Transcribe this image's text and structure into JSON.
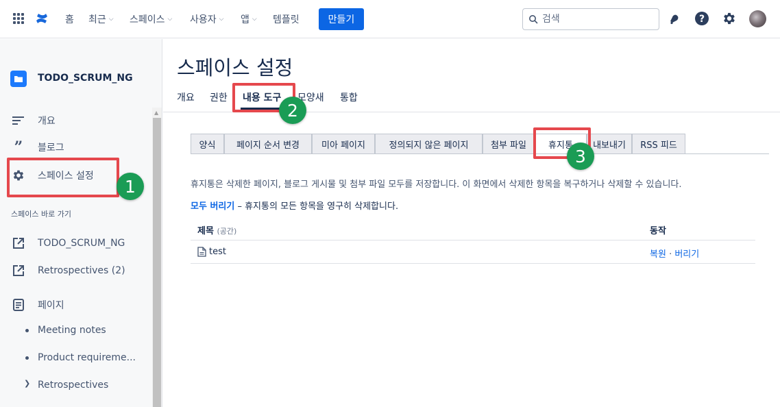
{
  "topnav": {
    "items": [
      {
        "label": "홈",
        "dropdown": false
      },
      {
        "label": "최근",
        "dropdown": true
      },
      {
        "label": "스페이스",
        "dropdown": true
      },
      {
        "label": "사용자",
        "dropdown": true
      },
      {
        "label": "앱",
        "dropdown": true
      },
      {
        "label": "템플릿",
        "dropdown": false
      }
    ],
    "create_label": "만들기",
    "search_placeholder": "검색",
    "brand_color": "#0c66e4"
  },
  "sidebar": {
    "space_name": "TODO_SCRUM_NG",
    "items": [
      {
        "label": "개요",
        "icon": "lines-icon"
      },
      {
        "label": "블로그",
        "icon": "quote-icon"
      },
      {
        "label": "스페이스 설정",
        "icon": "gear-icon"
      }
    ],
    "shortcuts_heading": "스페이스 바로 가기",
    "shortcuts": [
      {
        "label": "TODO_SCRUM_NG",
        "icon": "external-link-icon"
      },
      {
        "label": "Retrospectives (2)",
        "icon": "external-link-icon"
      }
    ],
    "pages_label": "페이지",
    "pages": [
      {
        "label": "Meeting notes",
        "marker": "bullet"
      },
      {
        "label": "Product requireme...",
        "marker": "bullet"
      },
      {
        "label": "Retrospectives",
        "marker": "caret"
      }
    ]
  },
  "main": {
    "title": "스페이스 설정",
    "tabs": [
      "개요",
      "권한",
      "내용 도구",
      "모양새",
      "통합"
    ],
    "active_tab": "내용 도구",
    "subtabs": [
      "양식",
      "페이지 순서 변경",
      "미아 페이지",
      "정의되지 않은 페이지",
      "첨부 파일",
      "휴지통",
      "내보내기",
      "RSS 피드"
    ],
    "active_subtab": "휴지통",
    "description": "휴지통은 삭제한 페이지, 블로그 게시물 및 첨부 파일 모두를 저장합니다. 이 화면에서 삭제한 항목을 복구하거나 삭제할 수 있습니다.",
    "purge_all_label": "모두 버리기",
    "purge_all_suffix": " – 휴지통의 모든 항목을 영구히 삭제합니다.",
    "table": {
      "col_title": "제목",
      "col_title_sub": "(공간)",
      "col_action": "동작",
      "rows": [
        {
          "title": "test",
          "restore": "복원",
          "separator": "·",
          "purge": "버리기"
        }
      ]
    }
  },
  "annotations": [
    {
      "number": "1",
      "color": "#1a9c55"
    },
    {
      "number": "2",
      "color": "#1a9c55"
    },
    {
      "number": "3",
      "color": "#1a9c55"
    }
  ]
}
